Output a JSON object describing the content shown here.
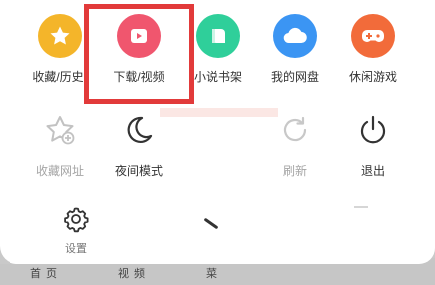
{
  "menu": {
    "row1": [
      {
        "label": "收藏/历史",
        "icon": "star-icon",
        "color": "#f4b52a"
      },
      {
        "label": "下载/视频",
        "icon": "play-icon",
        "color": "#f0566e"
      },
      {
        "label": "小说书架",
        "icon": "book-icon",
        "color": "#2fcf9a"
      },
      {
        "label": "我的网盘",
        "icon": "cloud-icon",
        "color": "#3b95f3"
      },
      {
        "label": "休闲游戏",
        "icon": "gamepad-icon",
        "color": "#f26b3a"
      }
    ],
    "row2": [
      {
        "label": "收藏网址",
        "icon": "add-star-icon"
      },
      {
        "label": "夜间模式",
        "icon": "moon-icon"
      },
      {
        "label": "刷新",
        "icon": "refresh-icon"
      },
      {
        "label": "退出",
        "icon": "power-icon"
      }
    ],
    "row3": [
      {
        "label": "设置",
        "icon": "gear-icon"
      }
    ]
  },
  "bottom_nav": {
    "items": [
      "首 页",
      "视 频",
      "菜"
    ]
  },
  "highlight_color": "#e23a3a"
}
